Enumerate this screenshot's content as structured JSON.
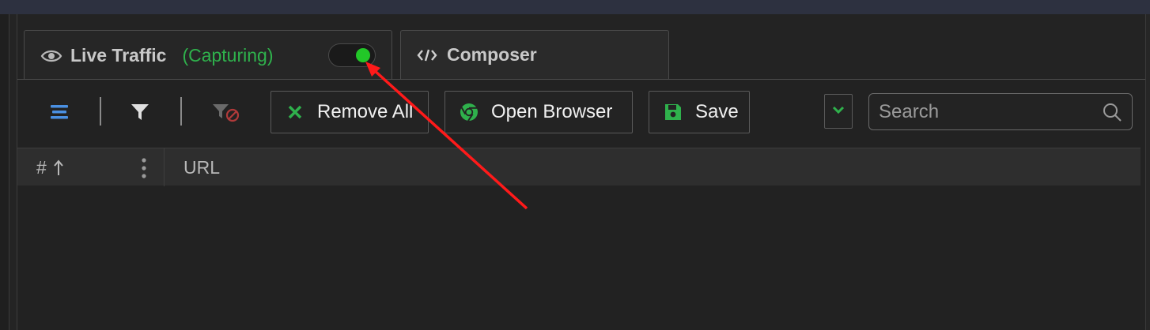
{
  "tabs": {
    "live": {
      "label": "Live Traffic",
      "status": "(Capturing)",
      "capture_on": true
    },
    "composer": {
      "label": "Composer"
    }
  },
  "toolbar": {
    "remove_all_label": "Remove All",
    "open_browser_label": "Open Browser",
    "save_label": "Save"
  },
  "search": {
    "placeholder": "Search",
    "value": ""
  },
  "grid": {
    "columns": [
      {
        "label": "#"
      },
      {
        "label": "URL"
      }
    ]
  },
  "icons": {
    "list": "list-icon",
    "filter": "filter-icon",
    "clear_filter": "filter-off-icon",
    "remove": "x-icon",
    "browser": "chrome-icon",
    "save": "floppy-icon",
    "dropdown": "chevron-down-icon",
    "search": "magnifier-icon",
    "sort": "arrow-up-icon",
    "column_menu": "kebab-icon"
  },
  "colors": {
    "accent_green": "#2fb14c",
    "toggle_green": "#22c728",
    "list_blue": "#4a90e2",
    "clear_filter_red": "#b03a3a",
    "annotation_red": "#ff1a1a"
  }
}
